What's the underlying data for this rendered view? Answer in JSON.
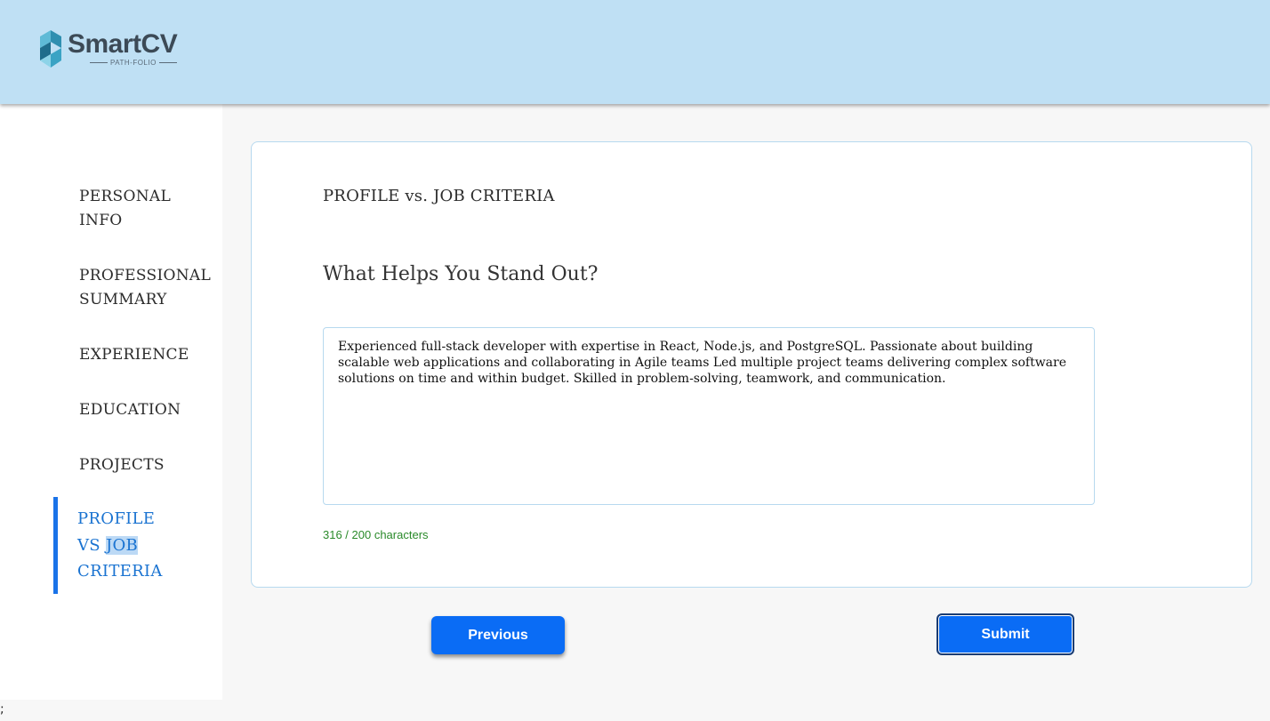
{
  "brand": {
    "name": "SmartCV",
    "tagline": "PATH-FOLIO"
  },
  "sidebar": {
    "items": [
      {
        "label": "PERSONAL INFO",
        "lines": [
          "PERSONAL",
          "INFO"
        ]
      },
      {
        "label": "PROFESSIONAL SUMMARY",
        "lines": [
          "PROFESSIONAL",
          "SUMMARY"
        ]
      },
      {
        "label": "EXPERIENCE"
      },
      {
        "label": "EDUCATION"
      },
      {
        "label": "PROJECTS"
      },
      {
        "label": "PROFILE VS JOB CRITERIA",
        "lines": [
          "PROFILE",
          "VS",
          "JOB",
          "CRITERIA"
        ],
        "active": true
      }
    ]
  },
  "main": {
    "title": "PROFILE vs. JOB CRITERIA",
    "heading": "What Helps You Stand Out?",
    "textarea_value": "Experienced full-stack developer with expertise in React, Node.js, and PostgreSQL. Passionate about building scalable web applications and collaborating in Agile teams Led multiple project teams delivering complex software solutions on time and within budget. Skilled in problem-solving, teamwork, and communication.",
    "char_counter": "316 / 200 characters",
    "counter_color": "#2a8a2a"
  },
  "buttons": {
    "previous": "Previous",
    "submit": "Submit"
  },
  "colors": {
    "header_bg": "#bfe0f4",
    "accent": "#0a6cf5",
    "active_nav": "#1a73d1"
  },
  "footer_text": ";"
}
